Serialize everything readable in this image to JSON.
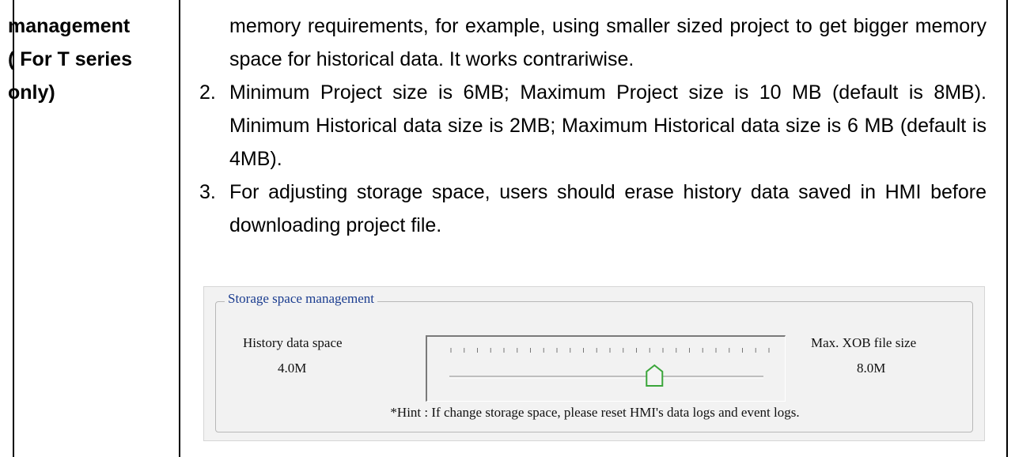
{
  "term": {
    "lines": [
      "management",
      "( For T series",
      "only)"
    ]
  },
  "description": {
    "continuation": "memory requirements, for example, using smaller sized project to get bigger memory space for historical data. It works contrariwise.",
    "items": [
      {
        "number": "2.",
        "text": "Minimum Project size is 6MB; Maximum Project size is 10 MB (default is 8MB). Minimum Historical data size is 2MB; Maximum Historical data size is 6 MB (default is 4MB)."
      },
      {
        "number": "3.",
        "text": "For adjusting storage space, users should erase history data saved in HMI before downloading project file."
      }
    ]
  },
  "dialog": {
    "group_title": "Storage space management",
    "history_label": "History data space",
    "history_value": "4.0M",
    "xob_label": "Max. XOB file size",
    "xob_value": "8.0M",
    "hint": "*Hint : If change storage space, please reset HMI's data logs and event logs.",
    "slider": {
      "min": 2,
      "max": 6,
      "value": 4,
      "tick_count": 25
    }
  }
}
